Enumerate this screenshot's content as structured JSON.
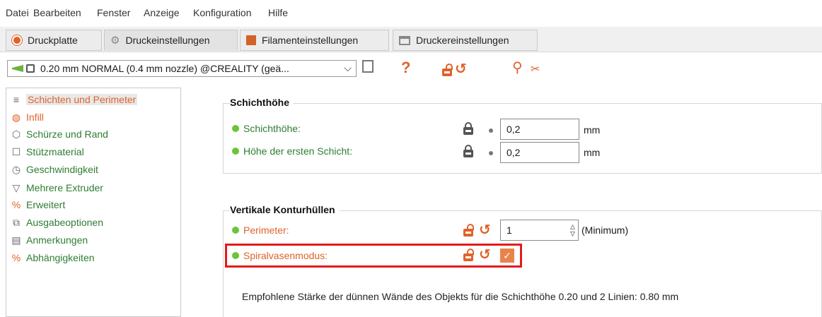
{
  "menu": [
    "Datei",
    "Bearbeiten",
    "Fenster",
    "Anzeige",
    "Konfiguration",
    "Hilfe"
  ],
  "tabs": [
    {
      "label": "Druckplatte",
      "icon": "plater-icon"
    },
    {
      "label": "Druckeinstellungen",
      "icon": "gear-icon"
    },
    {
      "label": "Filamenteinstellungen",
      "icon": "filament-icon"
    },
    {
      "label": "Druckereinstellungen",
      "icon": "printer-icon"
    }
  ],
  "toolbar": {
    "preset": "0.20 mm NORMAL (0.4 mm nozzle) @CREALITY (geä...",
    "help_glyph": "?"
  },
  "sidebar": {
    "items": [
      {
        "label": "Schichten und Perimeter",
        "icon": "layers-icon"
      },
      {
        "label": "Infill",
        "icon": "infill-icon"
      },
      {
        "label": "Schürze und Rand",
        "icon": "skirt-icon"
      },
      {
        "label": "Stützmaterial",
        "icon": "support-icon"
      },
      {
        "label": "Geschwindigkeit",
        "icon": "speed-icon"
      },
      {
        "label": "Mehrere Extruder",
        "icon": "funnel-icon"
      },
      {
        "label": "Erweitert",
        "icon": "wrench-icon"
      },
      {
        "label": "Ausgabeoptionen",
        "icon": "output-icon"
      },
      {
        "label": "Anmerkungen",
        "icon": "notes-icon"
      },
      {
        "label": "Abhängigkeiten",
        "icon": "wrench-icon"
      }
    ]
  },
  "layer_height_group": {
    "title": "Schichthöhe",
    "rows": [
      {
        "label": "Schichthöhe:",
        "value": "0,2",
        "unit": "mm"
      },
      {
        "label": "Höhe der ersten Schicht:",
        "value": "0,2",
        "unit": "mm"
      }
    ]
  },
  "vertical_shells_group": {
    "title": "Vertikale Konturhüllen",
    "perimeter": {
      "label": "Perimeter:",
      "value": "1",
      "unit": "(Minimum)"
    },
    "spiral": {
      "label": "Spiralvasenmodus:",
      "checked": true
    }
  },
  "note": "Empfohlene Stärke der dünnen Wände des Objekts für die Schichthöhe 0.20 und 2 Linien: 0.80 mm",
  "colors": {
    "accent_orange": "#e0622a",
    "label_green": "#2e7d32",
    "highlight_red": "#e31b1b"
  }
}
